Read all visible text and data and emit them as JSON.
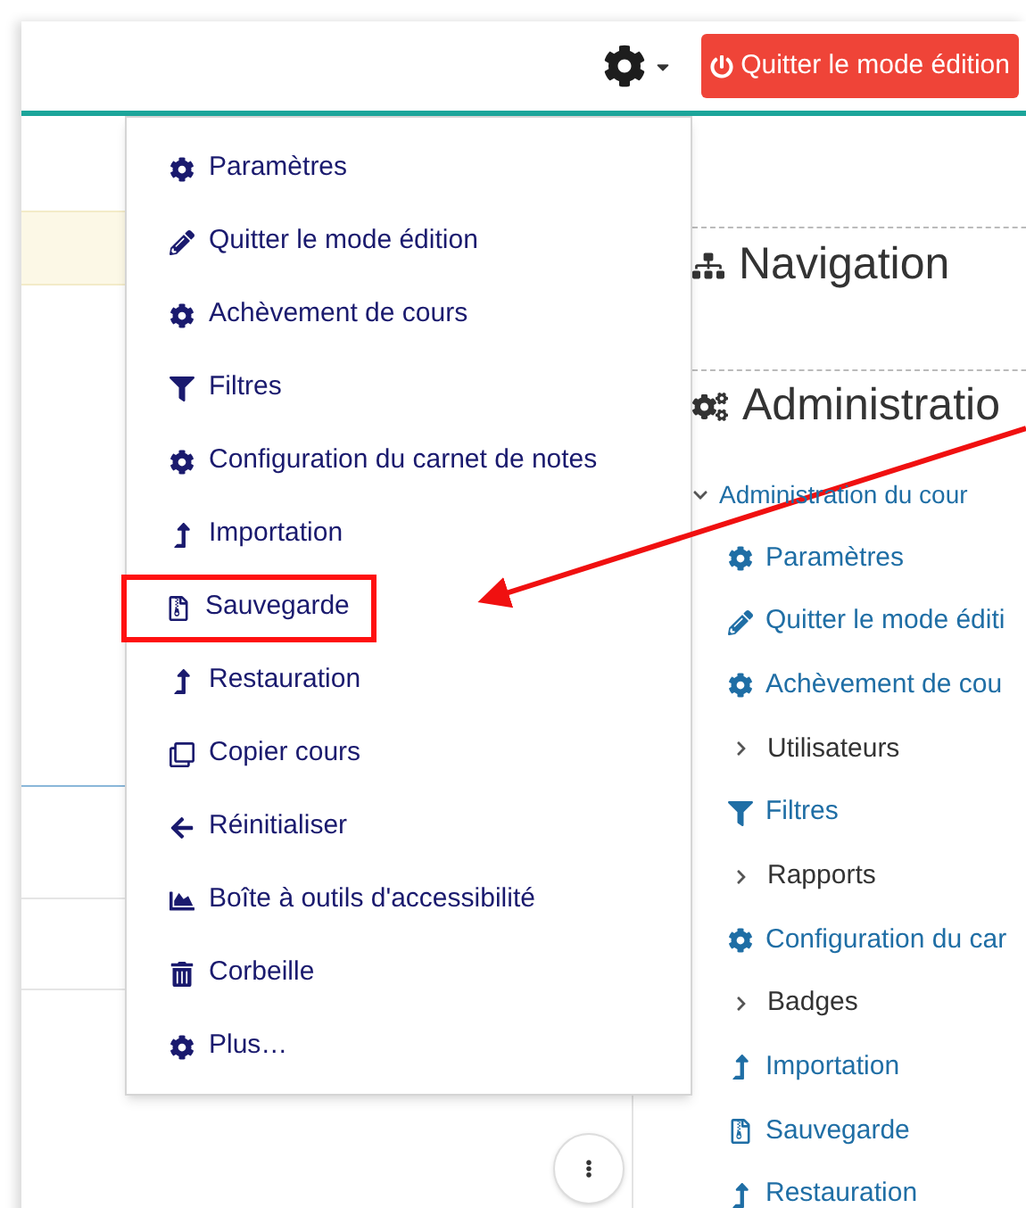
{
  "header": {
    "edit_button": "Quitter le mode édition"
  },
  "menu": [
    {
      "kind": "gear",
      "label": "Paramètres",
      "highlighted": false
    },
    {
      "kind": "pencil",
      "label": "Quitter le mode édition",
      "highlighted": false
    },
    {
      "kind": "gear",
      "label": "Achèvement de cours",
      "highlighted": false
    },
    {
      "kind": "filter",
      "label": "Filtres",
      "highlighted": false
    },
    {
      "kind": "gear",
      "label": "Configuration du carnet de notes",
      "highlighted": false
    },
    {
      "kind": "upload",
      "label": "Importation",
      "highlighted": false
    },
    {
      "kind": "file",
      "label": "Sauvegarde",
      "highlighted": true
    },
    {
      "kind": "upload",
      "label": "Restauration",
      "highlighted": false
    },
    {
      "kind": "copy",
      "label": "Copier cours",
      "highlighted": false
    },
    {
      "kind": "back",
      "label": "Réinitialiser",
      "highlighted": false
    },
    {
      "kind": "chart",
      "label": "Boîte à outils d'accessibilité",
      "highlighted": false
    },
    {
      "kind": "trash",
      "label": "Corbeille",
      "highlighted": false
    },
    {
      "kind": "gear",
      "label": "Plus…",
      "highlighted": false
    }
  ],
  "navigation": {
    "title": "Navigation"
  },
  "administration": {
    "title": "Administratio",
    "tree": {
      "label": "Administration du cour",
      "expanded": true,
      "children": [
        {
          "kind": "gear",
          "label": "Paramètres"
        },
        {
          "kind": "pencil",
          "label": "Quitter le mode éditi"
        },
        {
          "kind": "gear",
          "label": "Achèvement de cou"
        },
        {
          "kind": "branch",
          "label": "Utilisateurs",
          "expanded": false
        },
        {
          "kind": "filter",
          "label": "Filtres"
        },
        {
          "kind": "branch",
          "label": "Rapports",
          "expanded": false
        },
        {
          "kind": "gear",
          "label": "Configuration du car"
        },
        {
          "kind": "branch",
          "label": "Badges",
          "expanded": false
        },
        {
          "kind": "upload",
          "label": "Importation"
        },
        {
          "kind": "file",
          "label": "Sauvegarde"
        },
        {
          "kind": "upload",
          "label": "Restauration"
        }
      ]
    }
  }
}
